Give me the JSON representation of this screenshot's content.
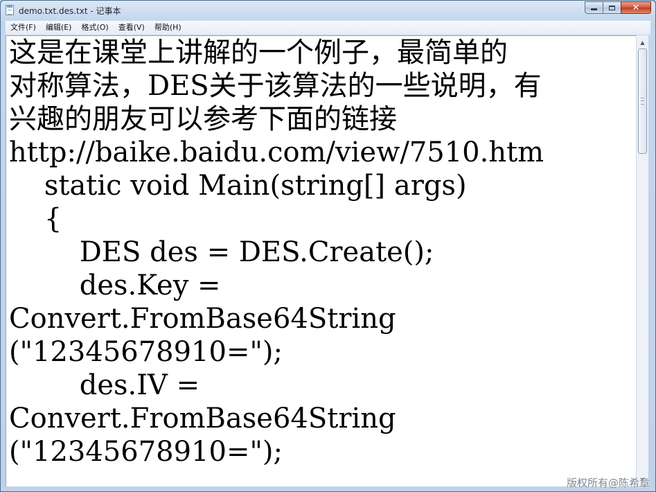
{
  "window": {
    "title": "demo.txt.des.txt - 记事本"
  },
  "menu": {
    "items": [
      "文件(F)",
      "编辑(E)",
      "格式(O)",
      "查看(V)",
      "帮助(H)"
    ]
  },
  "editor": {
    "lines": [
      "这是在课堂上讲解的一个例子，最简单的",
      "对称算法，DES关于该算法的一些说明，有",
      "兴趣的朋友可以参考下面的链接",
      "http://baike.baidu.com/view/7510.htm",
      "    static void Main(string[] args)",
      "    {",
      "        DES des = DES.Create();",
      "        des.Key =",
      "Convert.FromBase64String",
      "(\"12345678910=\");",
      "        des.IV =",
      "Convert.FromBase64String",
      "(\"12345678910=\");"
    ]
  },
  "watermark": "版权所有@陈希章",
  "icons": {
    "app": "notepad-icon",
    "minimize": "minimize-icon",
    "maximize": "maximize-icon",
    "close": "close-icon"
  }
}
